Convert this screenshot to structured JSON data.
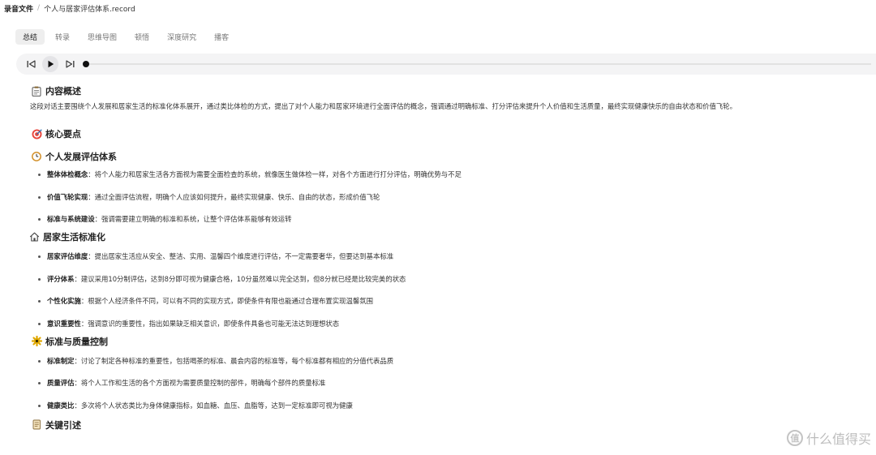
{
  "breadcrumb": {
    "root": "录音文件",
    "separator": "/",
    "current": "个人与居家评估体系.record"
  },
  "tabs": [
    {
      "label": "总结",
      "active": true
    },
    {
      "label": "转录"
    },
    {
      "label": "思维导图"
    },
    {
      "label": "顿悟"
    },
    {
      "label": "深度研究"
    },
    {
      "label": "播客"
    }
  ],
  "player": {
    "progress": 0.0
  },
  "overview": {
    "icon": "clipboard-icon",
    "title": "内容概述",
    "text": "这段对话主要围绕个人发展和居家生活的标准化体系展开，通过类比体检的方式，提出了对个人能力和居家环境进行全面评估的概念，强调通过明确标准、打分评估来提升个人价值和生活质量，最终实现健康快乐的自由状态和价值飞轮。"
  },
  "key_points": {
    "icon": "target-icon",
    "title": "核心要点"
  },
  "sections": [
    {
      "icon": "clock-icon",
      "title": "个人发展评估体系",
      "items": [
        {
          "term": "整体体检概念",
          "text": "将个人能力和居家生活各方面视为需要全面检查的系统，就像医生做体检一样，对各个方面进行打分评估，明确优势与不足"
        },
        {
          "term": "价值飞轮实现",
          "text": "通过全面评估流程，明确个人应该如何提升，最终实现健康、快乐、自由的状态，形成价值飞轮"
        },
        {
          "term": "标准与系统建设",
          "text": "强调需要建立明确的标准和系统，让整个评估体系能够有效运转"
        }
      ]
    },
    {
      "icon": "house-icon",
      "title": "居家生活标准化",
      "items": [
        {
          "term": "居家评估维度",
          "text": "提出居家生活应从安全、整洁、实用、温馨四个维度进行评估，不一定需要奢华，但要达到基本标准"
        },
        {
          "term": "评分体系",
          "text": "建议采用10分制评估，达到8分即可视为健康合格，10分虽然难以完全达到，但8分就已经是比较完美的状态"
        },
        {
          "term": "个性化实施",
          "text": "根据个人经济条件不同，可以有不同的实现方式，即使条件有限也能通过合理布置实现温馨氛围"
        },
        {
          "term": "意识重要性",
          "text": "强调意识的重要性，指出如果缺乏相关意识，即使条件具备也可能无法达到理想状态"
        }
      ]
    },
    {
      "icon": "gear-icon",
      "title": "标准与质量控制",
      "items": [
        {
          "term": "标准制定",
          "text": "讨论了制定各种标准的重要性，包括喝茶的标准、晨会内容的标准等，每个标准都有相应的分值代表品质"
        },
        {
          "term": "质量评估",
          "text": "将个人工作和生活的各个方面视为需要质量控制的部件，明确每个部件的质量标准"
        },
        {
          "term": "健康类比",
          "text": "多次将个人状态类比为身体健康指标，如血糖、血压、血脂等，达到一定标准即可视为健康"
        }
      ]
    }
  ],
  "quotes": {
    "icon": "scroll-icon",
    "title": "关键引述"
  },
  "watermark": {
    "logo": "值",
    "text": "什么值得买"
  }
}
